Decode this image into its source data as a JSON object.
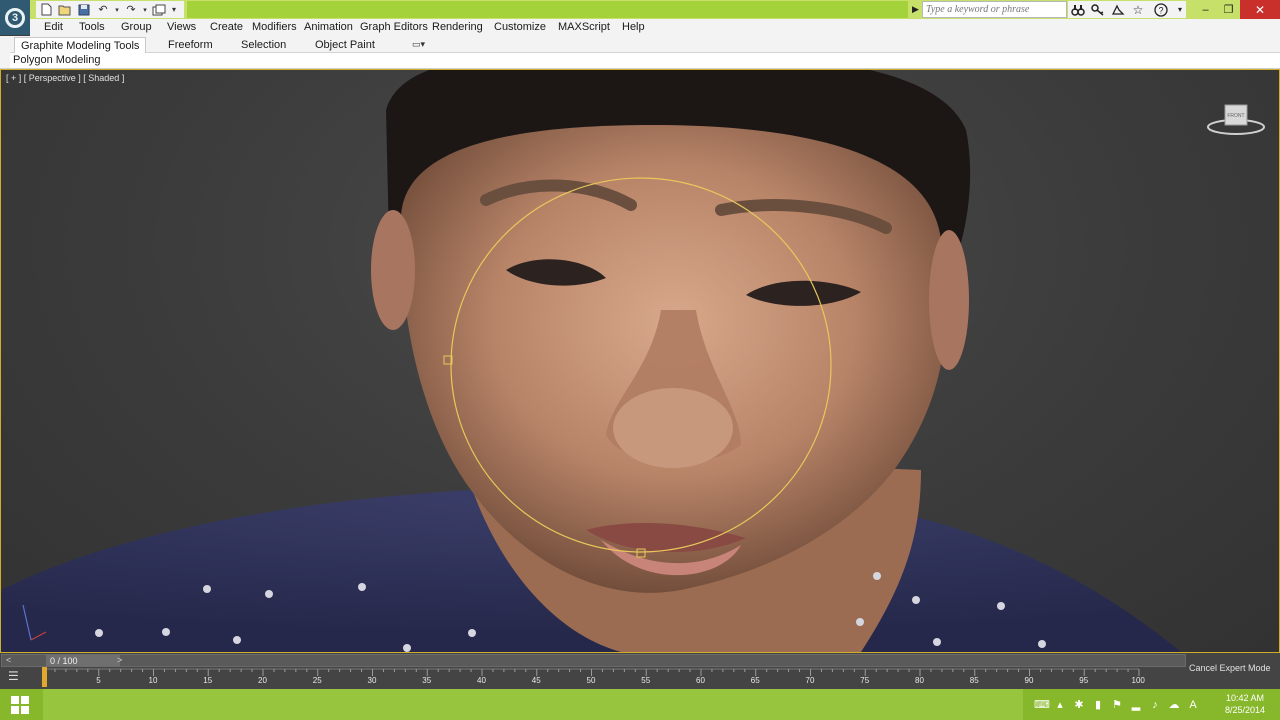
{
  "app": {
    "quick_access_icons": [
      "new-file-icon",
      "open-file-icon",
      "save-icon",
      "undo-icon",
      "redo-icon",
      "project-folder-icon"
    ],
    "search_placeholder": "Type a keyword or phrase",
    "info_icons": [
      "binoculars-icon",
      "key-icon",
      "subscription-icon",
      "favorites-star-icon",
      "help-icon"
    ]
  },
  "menubar": {
    "items": [
      "Edit",
      "Tools",
      "Group",
      "Views",
      "Create",
      "Modifiers",
      "Animation",
      "Graph Editors",
      "Rendering",
      "Customize",
      "MAXScript",
      "Help"
    ]
  },
  "ribbon": {
    "tabs": [
      "Graphite Modeling Tools",
      "Freeform",
      "Selection",
      "Object Paint"
    ],
    "active_tab": "Graphite Modeling Tools",
    "panel_label": "Polygon Modeling"
  },
  "viewport": {
    "label": "[ + ] [ Perspective ] [ Shaded ]",
    "viewcube_face": "FRONT"
  },
  "timeslider": {
    "prev_label": "<",
    "frame_display": "0 / 100",
    "next_label": ">",
    "cancel_expert_label": "Cancel Expert Mode",
    "ticks": [
      "5",
      "10",
      "15",
      "20",
      "25",
      "30",
      "35",
      "40",
      "45",
      "50",
      "55",
      "60",
      "65",
      "70",
      "75",
      "80",
      "85",
      "90",
      "95",
      "100"
    ]
  },
  "taskbar": {
    "time": "10:42 AM",
    "date": "8/25/2014",
    "ime_label": "A"
  },
  "colors": {
    "title_bar": "#c6e06a",
    "taskbar": "#87b72a",
    "viewport_border": "#cfae2a",
    "soft_selection_ring": "#e8c85a",
    "close_button": "#c9302c"
  }
}
